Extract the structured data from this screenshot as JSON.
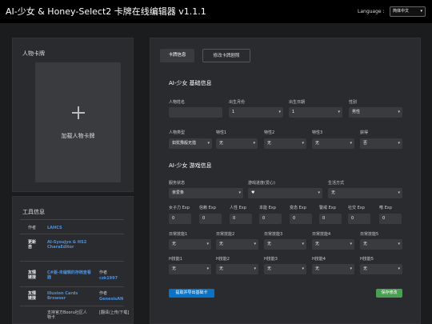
{
  "header": {
    "title": "AI-少女 & Honey-Select2 卡牌在线编辑器 v1.1.1",
    "language_label": "Language :",
    "language_value": "简体中文"
  },
  "left_panel": {
    "title": "人物卡牌",
    "upload_label": "加载人物卡牌"
  },
  "tools": {
    "title": "工具信息",
    "author_label": "作者",
    "author_value": "LAHCS",
    "update_label": "更新自",
    "update_value": "AI-Syoujyo & HS2 CharaEditor",
    "link1_label": "友情链接",
    "link1_title": "C#版-未编辑的存档查看器",
    "link1_author_label": "作者",
    "link1_author": "czk1997",
    "link2_label": "友情链接",
    "link2_title": "Illusion Cards Browser",
    "link2_author_label": "作者",
    "link2_author": "GenesisAN",
    "link3_title": "支持官方Booru社区人物卡",
    "link3_note": "[翻译/上传/下载]"
  },
  "tabs": [
    "卡牌信息",
    "修改卡牌剧照"
  ],
  "basic": {
    "title": "AI-少女 基础信息",
    "name_label": "人物姓名",
    "name_value": "",
    "month_label": "出生月份",
    "month_value": "1",
    "day_label": "出生日期",
    "day_value": "1",
    "gender_label": "性别",
    "gender_value": "男性",
    "type_label": "人物类型",
    "type_value": "如犹豫般无措",
    "t1_label": "特性1",
    "t1_value": "无",
    "t2_label": "特性2",
    "t2_value": "无",
    "t3_label": "特性3",
    "t3_value": "无",
    "fetish_label": "获得",
    "fetish_value": "否"
  },
  "game": {
    "title": "AI-少女 游戏信息",
    "state_label": "服务状态",
    "state_value": "亲爱条",
    "fav_label": "游戏进度(爱心)",
    "fav_value": "♥",
    "life_label": "生活方式",
    "life_value": "无",
    "exp": [
      {
        "label": "女子力 Exp",
        "value": "0"
      },
      {
        "label": "信赖 Exp",
        "value": "0"
      },
      {
        "label": "人性 Exp",
        "value": "0"
      },
      {
        "label": "本能 Exp",
        "value": "0"
      },
      {
        "label": "变态 Exp",
        "value": "0"
      },
      {
        "label": "警戒 Exp",
        "value": "0"
      },
      {
        "label": "社交 Exp",
        "value": "0"
      },
      {
        "label": "嗜 Exp",
        "value": "0"
      }
    ],
    "daily": [
      {
        "label": "日常技能1",
        "value": "无"
      },
      {
        "label": "日常技能2",
        "value": "无"
      },
      {
        "label": "日常技能3",
        "value": "无"
      },
      {
        "label": "日常技能4",
        "value": "无"
      },
      {
        "label": "日常技能5",
        "value": "无"
      }
    ],
    "h": [
      {
        "label": "H技能1",
        "value": "无"
      },
      {
        "label": "H技能2",
        "value": "无"
      },
      {
        "label": "H技能3",
        "value": "无"
      },
      {
        "label": "H技能4",
        "value": "无"
      },
      {
        "label": "H技能5",
        "value": "无"
      }
    ]
  },
  "buttons": {
    "extract": "提取并导出基础卡",
    "save": "保存修改"
  }
}
